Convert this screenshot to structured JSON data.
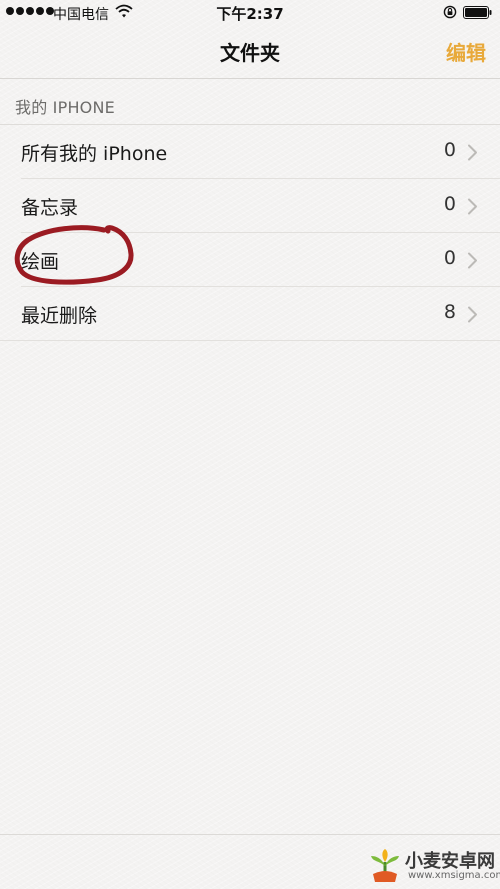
{
  "status_bar": {
    "carrier": "中国电信",
    "time": "下午2:37",
    "signal_bars": 5
  },
  "nav": {
    "title": "文件夹",
    "edit_label": "编辑"
  },
  "section": {
    "header": "我的 IPHONE"
  },
  "folders": [
    {
      "name": "所有我的 iPhone",
      "count": "0"
    },
    {
      "name": "备忘录",
      "count": "0"
    },
    {
      "name": "绘画",
      "count": "0"
    },
    {
      "name": "最近删除",
      "count": "8"
    }
  ],
  "colors": {
    "accent": "#e8a93a",
    "annotation": "#9b1b22",
    "background": "#f4f3f2"
  },
  "watermark": {
    "title": "小麦安卓网",
    "url": "www.xmsigma.com"
  }
}
